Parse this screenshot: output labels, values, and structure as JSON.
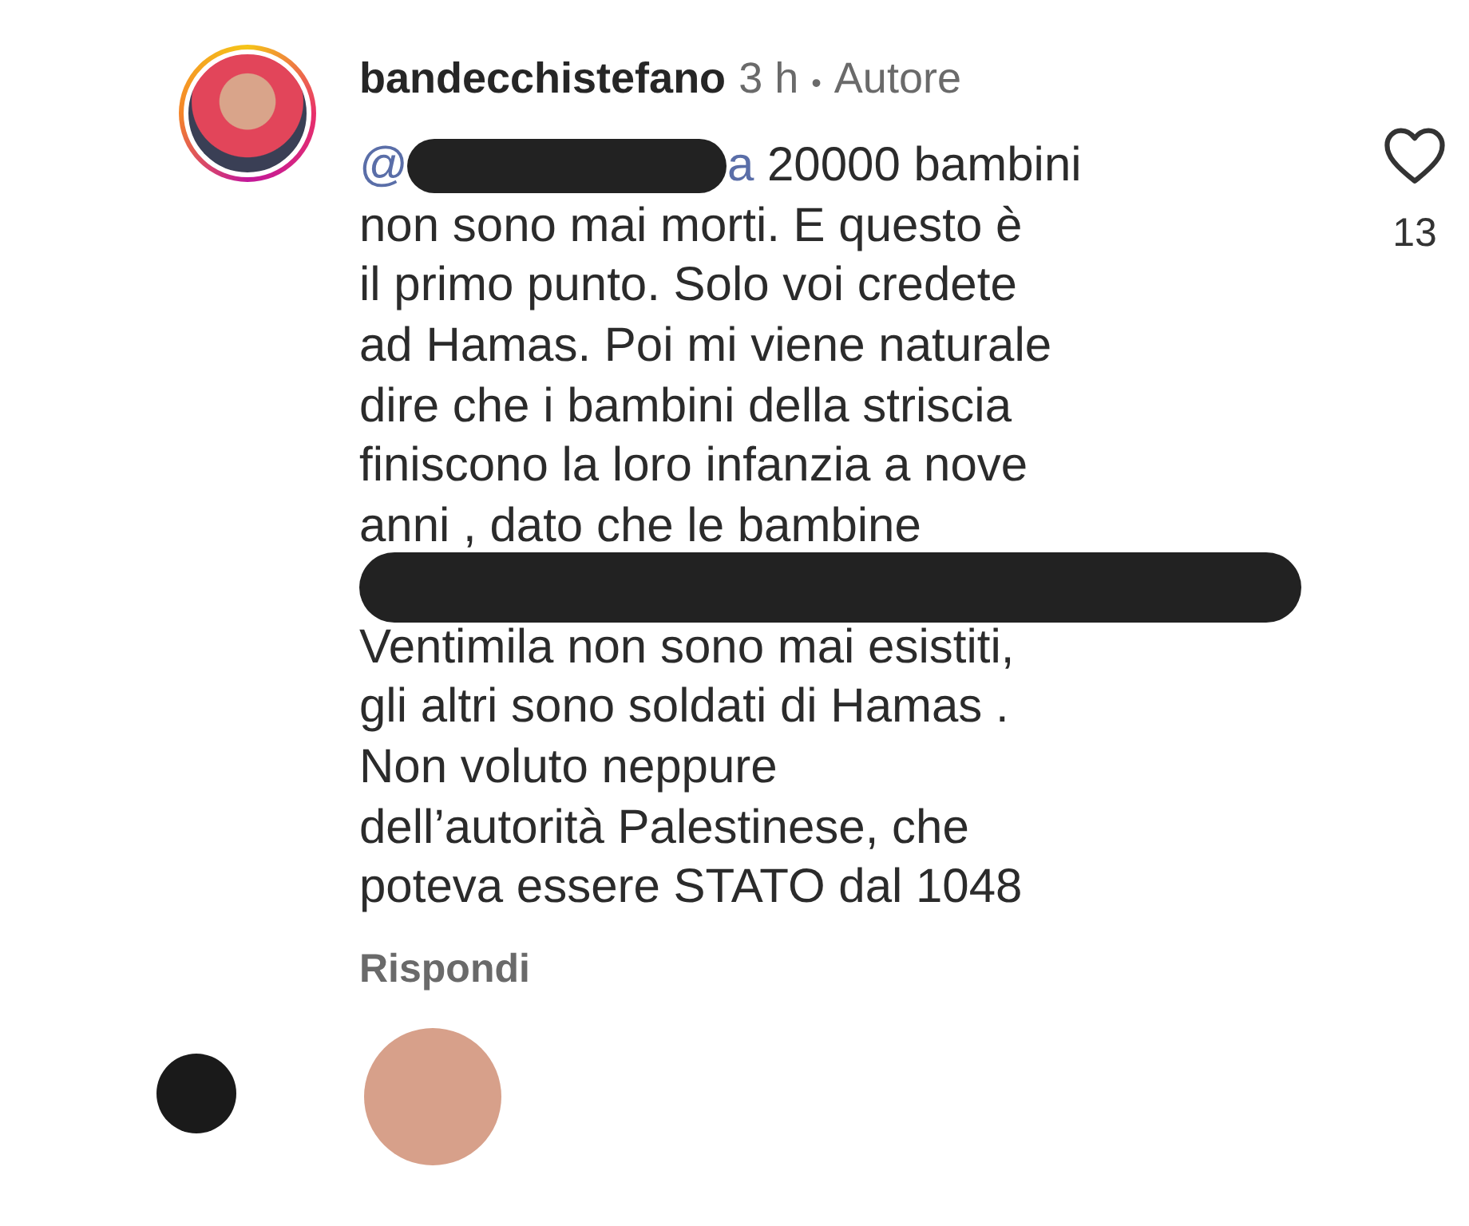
{
  "comment": {
    "username": "bandecchistefano",
    "time": "3 h",
    "separator": "•",
    "role": "Autore",
    "lines": [
      {
        "segments": [
          {
            "kind": "mention",
            "text": "@"
          },
          {
            "kind": "redaction"
          },
          {
            "kind": "mention",
            "text": "a"
          },
          {
            "kind": "text",
            "text": " 20000 bambini"
          }
        ]
      },
      {
        "segments": [
          {
            "kind": "text",
            "text": "non sono mai morti. E questo è"
          }
        ]
      },
      {
        "segments": [
          {
            "kind": "text",
            "text": "il primo punto. Solo voi credete"
          }
        ]
      },
      {
        "segments": [
          {
            "kind": "text",
            "text": "ad Hamas. Poi mi viene naturale"
          }
        ]
      },
      {
        "segments": [
          {
            "kind": "text",
            "text": "dire che i bambini della striscia"
          }
        ]
      },
      {
        "segments": [
          {
            "kind": "text",
            "text": "finiscono la loro infanzia a nove"
          }
        ]
      },
      {
        "segments": [
          {
            "kind": "text",
            "text": "anni , dato che le bambine"
          }
        ]
      },
      {
        "segments": [
          {
            "kind": "redaction"
          }
        ]
      },
      {
        "segments": [
          {
            "kind": "text",
            "text": "Ventimila non sono mai esistiti,"
          }
        ]
      },
      {
        "segments": [
          {
            "kind": "text",
            "text": "gli altri sono soldati di Hamas ."
          }
        ]
      },
      {
        "segments": [
          {
            "kind": "text",
            "text": "Non voluto neppure"
          }
        ]
      },
      {
        "segments": [
          {
            "kind": "text",
            "text": "dell’autorità Palestinese, che"
          }
        ]
      },
      {
        "segments": [
          {
            "kind": "text",
            "text": "poteva essere STATO dal 1048"
          }
        ]
      }
    ],
    "likes": "13",
    "reply": "Rispondi"
  }
}
